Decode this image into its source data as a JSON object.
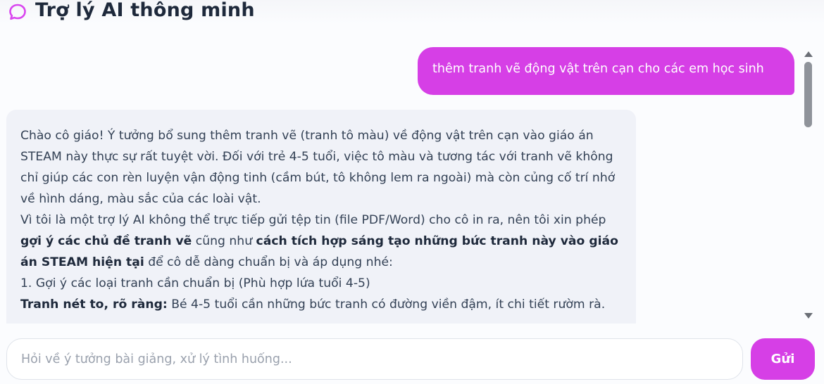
{
  "header": {
    "title": "Trợ lý AI thông minh",
    "icon": "chat-bubble-icon",
    "accent_color": "#d946ef"
  },
  "messages": {
    "user": {
      "text": "thêm tranh vẽ động vật trên cạn cho các em học sinh"
    },
    "assistant": {
      "paragraphs": [
        [
          {
            "text": "Chào cô giáo! Ý tưởng bổ sung thêm tranh vẽ (tranh tô màu) về động vật trên cạn vào giáo án STEAM này thực sự rất tuyệt vời. Đối với trẻ 4-5 tuổi, việc tô màu và tương tác với tranh vẽ không chỉ giúp các con rèn luyện vận động tinh (cầm bút, tô không lem ra ngoài) mà còn củng cố trí nhớ về hình dáng, màu sắc của các loài vật.",
            "bold": false
          }
        ],
        [
          {
            "text": "Vì tôi là một trợ lý AI không thể trực tiếp gửi tệp tin (file PDF/Word) cho cô in ra, nên tôi xin phép ",
            "bold": false
          },
          {
            "text": "gợi ý các chủ đề tranh vẽ",
            "bold": true
          },
          {
            "text": " cũng như ",
            "bold": false
          },
          {
            "text": "cách tích hợp sáng tạo những bức tranh này vào giáo án STEAM hiện tại",
            "bold": true
          },
          {
            "text": " để cô dễ dàng chuẩn bị và áp dụng nhé:",
            "bold": false
          }
        ],
        [
          {
            "text": "1. Gợi ý các loại tranh cần chuẩn bị (Phù hợp lứa tuổi 4-5)",
            "bold": false
          }
        ],
        [
          {
            "text": "Tranh nét to, rõ ràng:",
            "bold": true
          },
          {
            "text": " Bé 4-5 tuổi cần những bức tranh có đường viền đậm, ít chi tiết rườm rà.",
            "bold": false
          }
        ]
      ]
    }
  },
  "composer": {
    "placeholder": "Hỏi về ý tưởng bài giảng, xử lý tình huống...",
    "value": "",
    "send_label": "Gửi",
    "button_color": "#d63fe6"
  }
}
